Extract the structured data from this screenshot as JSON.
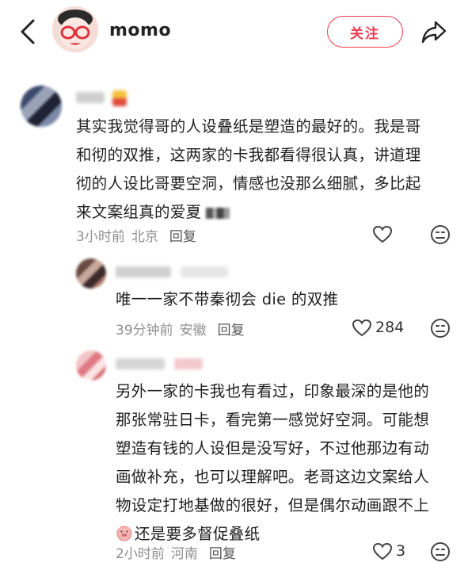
{
  "header": {
    "username": "momo",
    "follow_label": "关注"
  },
  "comments": [
    {
      "text": "其实我觉得哥的人设叠纸是塑造的最好的。我是哥\n和彻的双推，这两家的卡我都看得很认真，讲道理\n彻的人设比哥要空洞，情感也没那么细腻，多比起\n来文案组真的爱夏",
      "time": "3小时前",
      "location": "北京",
      "reply_label": "回复",
      "likes": ""
    },
    {
      "text": "唯一一家不带秦彻会 die 的双推",
      "time": "39分钟前",
      "location": "安徽",
      "reply_label": "回复",
      "likes": "284"
    },
    {
      "text": "另外一家的卡我也有看过，印象最深的是他的\n那张常驻日卡，看完第一感觉好空洞。可能想\n塑造有钱的人设但是没写好，不过他那边有动\n画做补充，也可以理解吧。老哥这边文案给人\n物设定打地基做的很好，但是偶尔动画跟不上\n",
      "text_tail": "还是要多督促叠纸",
      "time": "2小时前",
      "location": "河南",
      "reply_label": "回复",
      "likes": "3"
    }
  ],
  "colors": {
    "accent": "#ee3b4f",
    "meta_gray": "#8f8f8f"
  }
}
